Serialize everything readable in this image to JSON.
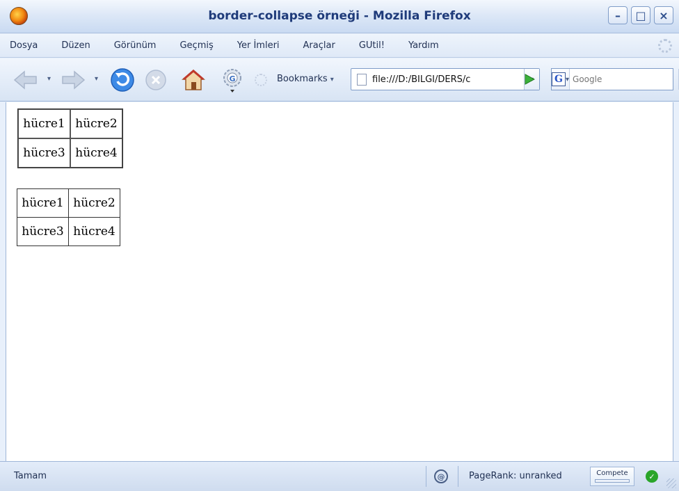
{
  "window": {
    "title": "border-collapse örneği - Mozilla Firefox",
    "minimize_label": "–",
    "maximize_label": "□",
    "close_label": "×"
  },
  "menu": {
    "items": [
      "Dosya",
      "Düzen",
      "Görünüm",
      "Geçmiş",
      "Yer İmleri",
      "Araçlar",
      "GUtil!",
      "Yardım"
    ]
  },
  "toolbar": {
    "bookmarks_label": "Bookmarks",
    "url": "file:///D:/BILGI/DERS/c",
    "search_placeholder": "Google",
    "search_engine_logo": "G"
  },
  "content": {
    "table_separate": {
      "rows": [
        [
          "hücre1",
          "hücre2"
        ],
        [
          "hücre3",
          "hücre4"
        ]
      ]
    },
    "table_collapse": {
      "rows": [
        [
          "hücre1",
          "hücre2"
        ],
        [
          "hücre3",
          "hücre4"
        ]
      ]
    }
  },
  "status": {
    "text": "Tamam",
    "pagerank": "PageRank: unranked",
    "compete_label": "Compete"
  },
  "icons": {
    "app": "firefox-icon",
    "back": "back-arrow-icon",
    "forward": "forward-arrow-icon",
    "reload": "reload-icon",
    "stop": "stop-icon",
    "home": "home-icon",
    "extension": "gutil-icon",
    "throbber": "throbber-icon",
    "go": "go-arrow-icon",
    "search": "magnifier-icon",
    "ok": "check-icon"
  },
  "colors": {
    "title_text": "#1f3b7a",
    "chrome_bg": "#dde8f7",
    "reload_blue": "#2f7de0",
    "go_green": "#2ea62e"
  }
}
